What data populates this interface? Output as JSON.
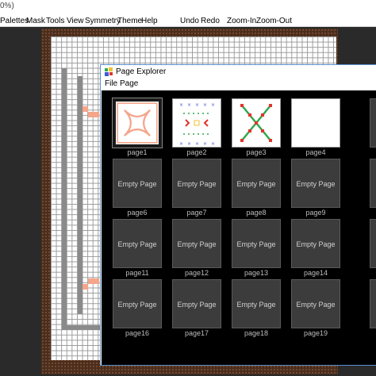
{
  "window": {
    "title_fragment": "0%)"
  },
  "menubar": {
    "items": [
      "Palettes",
      "Mask",
      "Tools",
      "View",
      "Symmetry",
      "Theme",
      "Help",
      "Undo",
      "Redo",
      "Zoom-In",
      "Zoom-Out"
    ]
  },
  "page_explorer": {
    "title": "Page Explorer",
    "menu": [
      "File",
      "Page"
    ],
    "empty_label": "Empty Page",
    "pages": [
      {
        "label": "page1",
        "kind": "selected-art"
      },
      {
        "label": "page2",
        "kind": "art-cross"
      },
      {
        "label": "page3",
        "kind": "art-x"
      },
      {
        "label": "page4",
        "kind": "blank"
      },
      {
        "label": "page6",
        "kind": "empty"
      },
      {
        "label": "page7",
        "kind": "empty"
      },
      {
        "label": "page8",
        "kind": "empty"
      },
      {
        "label": "page9",
        "kind": "empty"
      },
      {
        "label": "page11",
        "kind": "empty"
      },
      {
        "label": "page12",
        "kind": "empty"
      },
      {
        "label": "page13",
        "kind": "empty"
      },
      {
        "label": "page14",
        "kind": "empty"
      },
      {
        "label": "page16",
        "kind": "empty"
      },
      {
        "label": "page17",
        "kind": "empty"
      },
      {
        "label": "page18",
        "kind": "empty"
      },
      {
        "label": "page19",
        "kind": "empty"
      }
    ]
  },
  "colors": {
    "accent": "#5a8fd0",
    "salmon": "#f4a58a",
    "frame": "#4a2e1e",
    "green": "#2fa84f",
    "red": "#e0352b",
    "blue": "#3b5bdb"
  }
}
